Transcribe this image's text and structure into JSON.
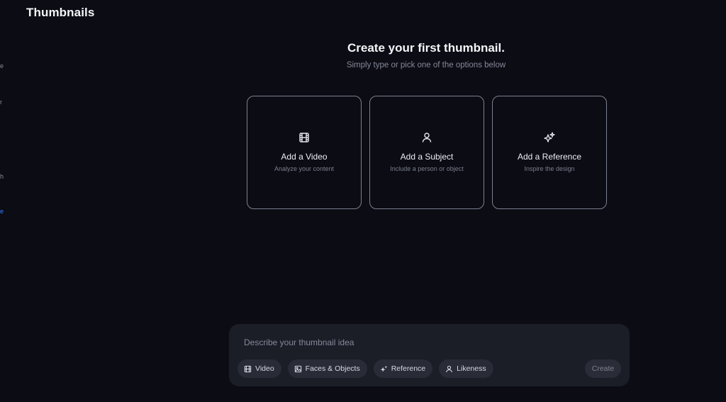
{
  "app": {
    "title": "Thumbnails"
  },
  "sidebar_fragments": [
    {
      "text": "e",
      "active": false
    },
    {
      "text": "r",
      "active": false
    },
    {
      "text": "h",
      "active": false
    },
    {
      "text": "e",
      "active": true
    }
  ],
  "hero": {
    "title": "Create your first thumbnail.",
    "subtitle": "Simply type or pick one of the options below"
  },
  "cards": [
    {
      "icon": "film-icon",
      "title": "Add a Video",
      "subtitle": "Analyze your content"
    },
    {
      "icon": "person-icon",
      "title": "Add a Subject",
      "subtitle": "Include a person or object"
    },
    {
      "icon": "sparkles-icon",
      "title": "Add a Reference",
      "subtitle": "Inspire the design"
    }
  ],
  "composer": {
    "placeholder": "Describe your thumbnail idea",
    "value": "",
    "chips": [
      {
        "icon": "film-icon",
        "label": "Video"
      },
      {
        "icon": "image-icon",
        "label": "Faces & Objects"
      },
      {
        "icon": "sparkles-icon",
        "label": "Reference"
      },
      {
        "icon": "person-icon",
        "label": "Likeness"
      }
    ],
    "create_label": "Create"
  },
  "colors": {
    "background": "#0b0c14",
    "card_border": "#7d8090",
    "composer_bg": "#1b1d27",
    "chip_bg": "#292b37",
    "active_link": "#3a7bff"
  }
}
